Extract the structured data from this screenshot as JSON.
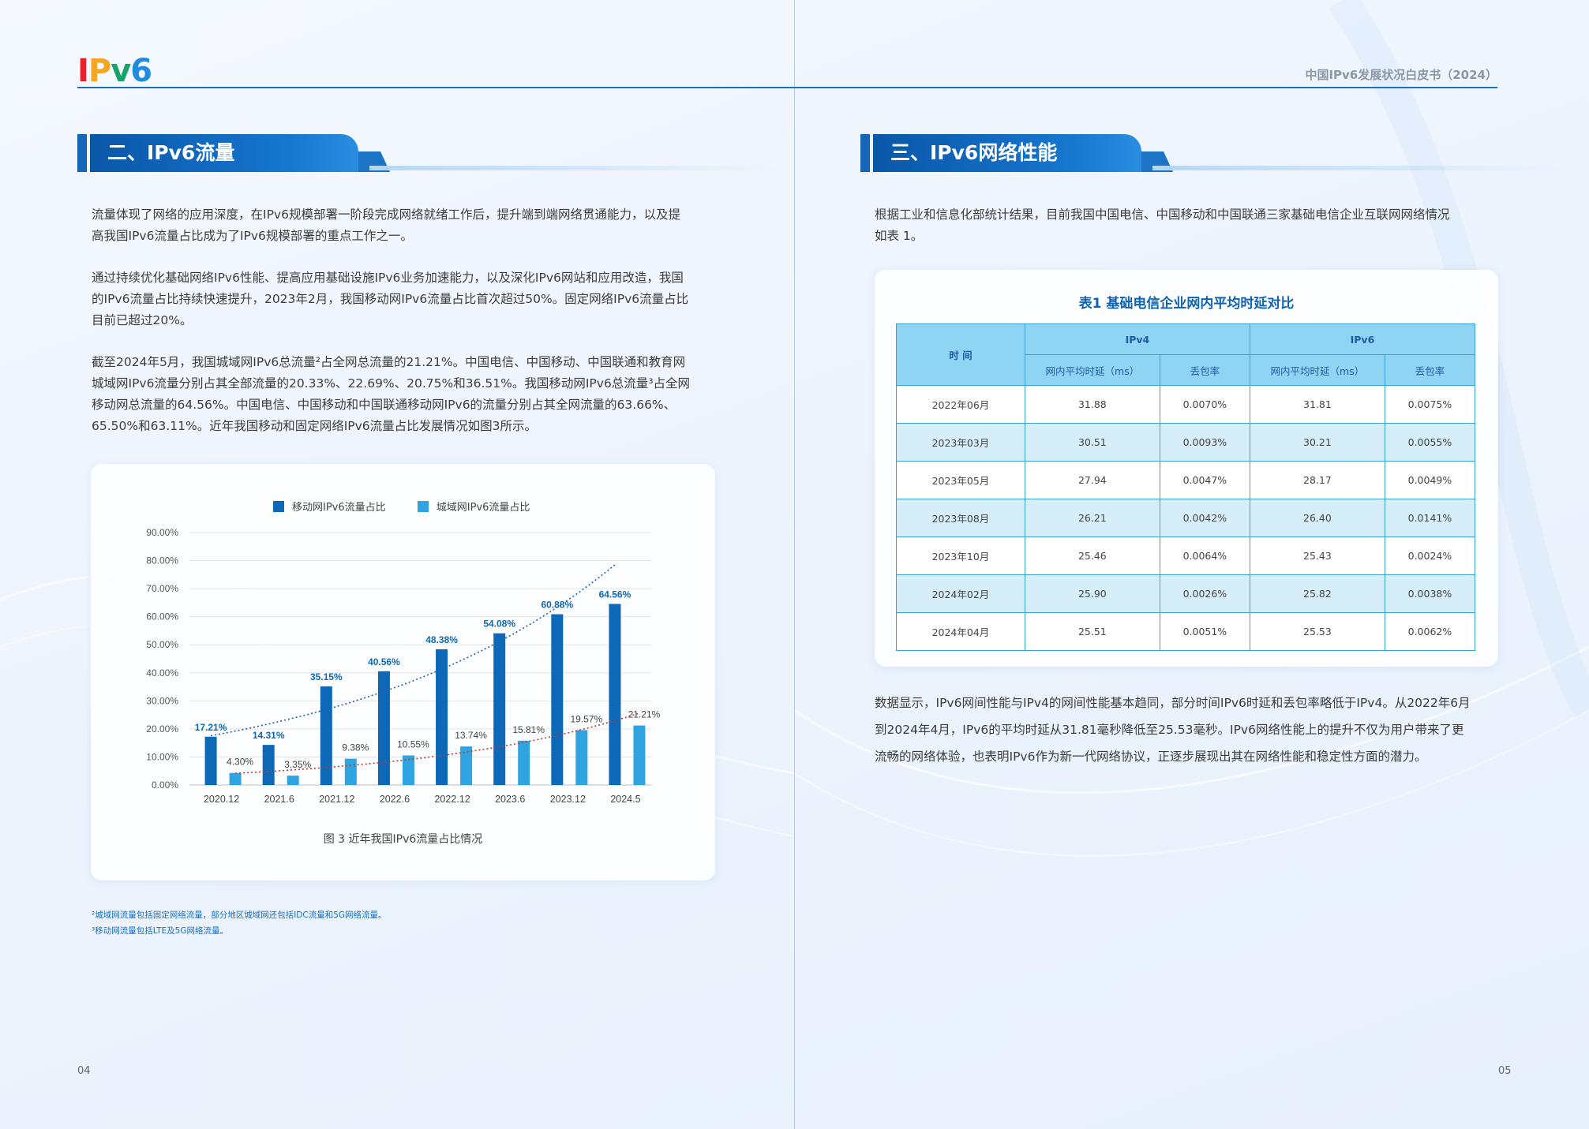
{
  "header": {
    "logo_text": "IPv6",
    "doc_title": "中国IPv6发展状况白皮书（2024）"
  },
  "left": {
    "section_title": "二、IPv6流量",
    "paragraphs": [
      [
        "流量体现了网络的应用深度，在IPv6规模部署一阶段完成网络就绪工作后，提升端到端网络贯通能力，以及提",
        "高我国IPv6流量占比成为了IPv6规模部署的重点工作之一。"
      ],
      [
        "通过持续优化基础网络IPv6性能、提高应用基础设施IPv6业务加速能力，以及深化IPv6网站和应用改造，我国",
        "的IPv6流量占比持续快速提升，2023年2月，我国移动网IPv6流量占比首次超过50%。固定网络IPv6流量占比",
        "目前已超过20%。"
      ],
      [
        "截至2024年5月，我国城域网IPv6总流量²占全网总流量的21.21%。中国电信、中国移动、中国联通和教育网",
        "城域网IPv6流量分别占其全部流量的20.33%、22.69%、20.75%和36.51%。我国移动网IPv6总流量³占全网",
        "移动网总流量的64.56%。中国电信、中国移动和中国联通移动网IPv6的流量分别占其全网流量的63.66%、",
        "65.50%和63.11%。近年我国移动和固定网络IPv6流量占比发展情况如图3所示。"
      ]
    ],
    "figure_caption": "图 3 近年我国IPv6流量占比情况",
    "footnotes": [
      "²城域网流量包括固定网络流量，部分地区城域网还包括IDC流量和5G网络流量。",
      "³移动网流量包括LTE及5G网络流量。"
    ],
    "page_number": "04"
  },
  "right": {
    "section_title": "三、IPv6网络性能",
    "intro": [
      "根据工业和信息化部统计结果，目前我国中国电信、中国移动和中国联通三家基础电信企业互联网网络情况",
      "如表 1。"
    ],
    "table": {
      "title": "表1 基础电信企业网内平均时延对比",
      "col_time": "时 间",
      "group_ipv4": "IPv4",
      "group_ipv6": "IPv6",
      "sub_latency": "网内平均时延（ms）",
      "sub_loss": "丢包率",
      "rows": [
        [
          "2022年06月",
          "31.88",
          "0.0070%",
          "31.81",
          "0.0075%"
        ],
        [
          "2023年03月",
          "30.51",
          "0.0093%",
          "30.21",
          "0.0055%"
        ],
        [
          "2023年05月",
          "27.94",
          "0.0047%",
          "28.17",
          "0.0049%"
        ],
        [
          "2023年08月",
          "26.21",
          "0.0042%",
          "26.40",
          "0.0141%"
        ],
        [
          "2023年10月",
          "25.46",
          "0.0064%",
          "25.43",
          "0.0024%"
        ],
        [
          "2024年02月",
          "25.90",
          "0.0026%",
          "25.82",
          "0.0038%"
        ],
        [
          "2024年04月",
          "25.51",
          "0.0051%",
          "25.53",
          "0.0062%"
        ]
      ]
    },
    "conclusion": [
      "数据显示，IPv6网间性能与IPv4的网间性能基本趋同，部分时间IPv6时延和丢包率略低于IPv4。从2022年6月",
      "到2024年4月，IPv6的平均时延从31.81毫秒降低至25.53毫秒。IPv6网络性能上的提升不仅为用户带来了更",
      "流畅的网络体验，也表明IPv6作为新一代网络协议，正逐步展现出其在网络性能和稳定性方面的潜力。"
    ],
    "page_number": "05"
  },
  "chart_data": {
    "type": "bar",
    "categories": [
      "2020.12",
      "2021.6",
      "2021.12",
      "2022.6",
      "2022.12",
      "2023.6",
      "2023.12",
      "2024.5"
    ],
    "series": [
      {
        "name": "移动网IPv6流量占比",
        "values": [
          17.21,
          14.31,
          35.15,
          40.56,
          48.38,
          54.08,
          60.88,
          64.56
        ],
        "labels": [
          "17.21%",
          "14.31%",
          "35.15%",
          "40.56%",
          "48.38%",
          "54.08%",
          "60.88%",
          "64.56%"
        ],
        "color": "#0e68b8"
      },
      {
        "name": "城域网IPv6流量占比",
        "values": [
          4.3,
          3.35,
          9.38,
          10.55,
          13.74,
          15.81,
          19.57,
          21.21
        ],
        "labels": [
          "4.30%",
          "3.35%",
          "9.38%",
          "10.55%",
          "13.74%",
          "15.81%",
          "19.57%",
          "21.21%"
        ],
        "color": "#2fa4e0"
      }
    ],
    "trendlines": [
      {
        "series": "移动网IPv6流量占比",
        "style": "dotted",
        "color": "#1e5fb0"
      },
      {
        "series": "城域网IPv6流量占比",
        "style": "dotted",
        "color": "#c0392b"
      }
    ],
    "yticks": [
      "0.00%",
      "10.00%",
      "20.00%",
      "30.00%",
      "40.00%",
      "50.00%",
      "60.00%",
      "70.00%",
      "80.00%",
      "90.00%"
    ],
    "ylim": [
      0,
      90
    ],
    "legend_position": "top",
    "grid": true
  }
}
